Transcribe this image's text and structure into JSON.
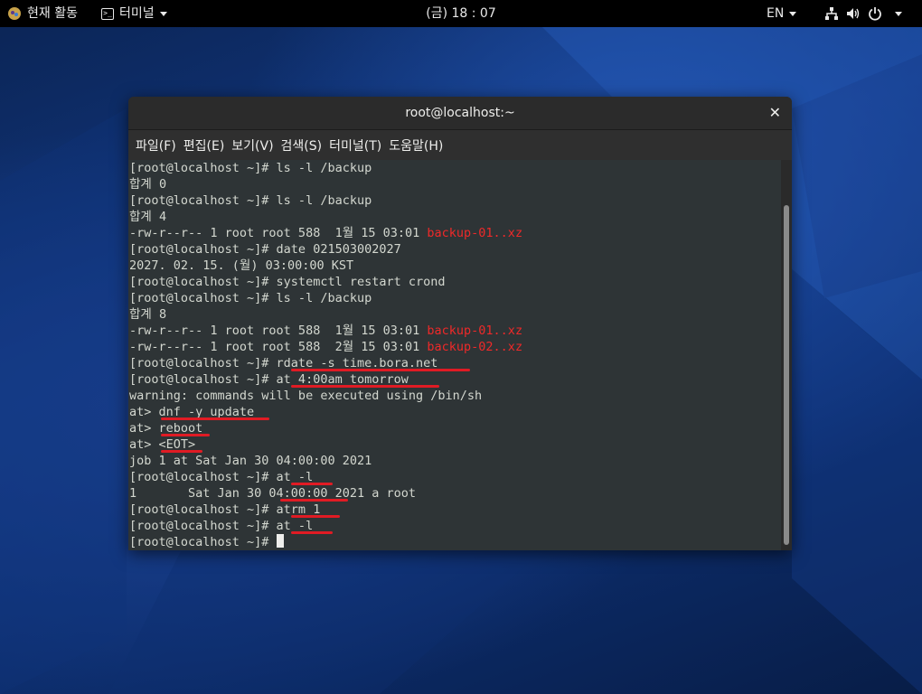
{
  "topbar": {
    "activities_label": "현재 활동",
    "app_label": "터미널",
    "clock": "(금) 18 : 07",
    "language": "EN"
  },
  "window": {
    "title": "root@localhost:~",
    "close_glyph": "✕",
    "menu": [
      "파일(F)",
      "편집(E)",
      "보기(V)",
      "검색(S)",
      "터미널(T)",
      "도움말(H)"
    ]
  },
  "terminal": {
    "lines": [
      {
        "text": "[root@localhost ~]# ls -l /backup",
        "red": ""
      },
      {
        "text": "합계 0",
        "red": ""
      },
      {
        "text": "[root@localhost ~]# ls -l /backup",
        "red": ""
      },
      {
        "text": "합계 4",
        "red": ""
      },
      {
        "text": "-rw-r--r-- 1 root root 588  1월 15 03:01 ",
        "red": "backup-01..xz"
      },
      {
        "text": "[root@localhost ~]# date 021503002027",
        "red": ""
      },
      {
        "text": "2027. 02. 15. (월) 03:00:00 KST",
        "red": ""
      },
      {
        "text": "[root@localhost ~]# systemctl restart crond",
        "red": ""
      },
      {
        "text": "[root@localhost ~]# ls -l /backup",
        "red": ""
      },
      {
        "text": "합계 8",
        "red": ""
      },
      {
        "text": "-rw-r--r-- 1 root root 588  1월 15 03:01 ",
        "red": "backup-01..xz"
      },
      {
        "text": "-rw-r--r-- 1 root root 588  2월 15 03:01 ",
        "red": "backup-02..xz"
      },
      {
        "text": "[root@localhost ~]# rdate -s time.bora.net",
        "red": ""
      },
      {
        "text": "[root@localhost ~]# at 4:00am tomorrow",
        "red": ""
      },
      {
        "text": "warning: commands will be executed using /bin/sh",
        "red": ""
      },
      {
        "text": "at> dnf -y update",
        "red": ""
      },
      {
        "text": "at> reboot",
        "red": ""
      },
      {
        "text": "at> <EOT>",
        "red": ""
      },
      {
        "text": "job 1 at Sat Jan 30 04:00:00 2021",
        "red": ""
      },
      {
        "text": "[root@localhost ~]# at -l",
        "red": ""
      },
      {
        "text": "1       Sat Jan 30 04:00:00 2021 a root",
        "red": ""
      },
      {
        "text": "[root@localhost ~]# atrm 1",
        "red": ""
      },
      {
        "text": "[root@localhost ~]# at -l",
        "red": ""
      },
      {
        "text": "[root@localhost ~]# ",
        "red": ""
      }
    ]
  },
  "colors": {
    "terminal_bg": "#2e3436",
    "terminal_fg": "#d3d7cf",
    "filename_red": "#ef2929",
    "annotation_red": "#e01b24"
  }
}
